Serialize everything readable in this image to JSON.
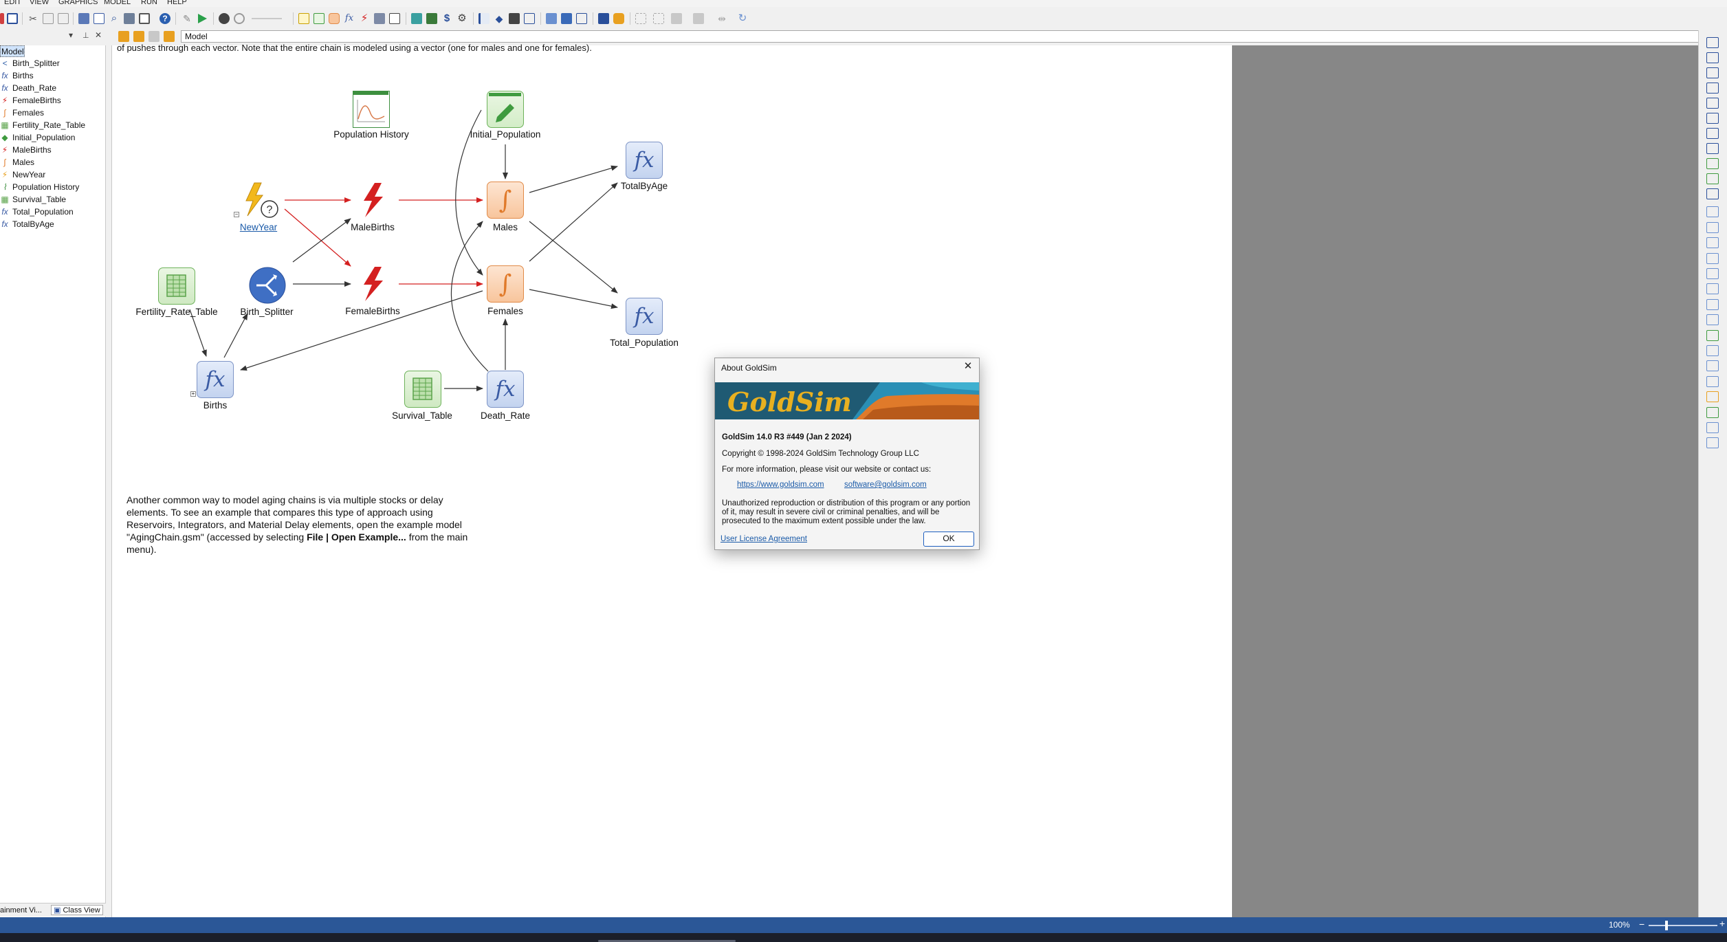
{
  "menu": [
    "EDIT",
    "VIEW",
    "GRAPHICS",
    "MODEL",
    "RUN",
    "HELP"
  ],
  "path_bar": "Model",
  "tree": {
    "root": "Model",
    "items": [
      {
        "label": "Birth_Splitter",
        "icon": "splitter-icon",
        "glyph": "<",
        "color": "#2f5fa8"
      },
      {
        "label": "Births",
        "icon": "function-icon",
        "glyph": "fx",
        "color": "#3a5ba4"
      },
      {
        "label": "Death_Rate",
        "icon": "function-icon",
        "glyph": "fx",
        "color": "#3a5ba4"
      },
      {
        "label": "FemaleBirths",
        "icon": "event-icon",
        "glyph": "⚡",
        "color": "#d42020"
      },
      {
        "label": "Females",
        "icon": "integrator-icon",
        "glyph": "∫",
        "color": "#e07a2a"
      },
      {
        "label": "Fertility_Rate_Table",
        "icon": "table-icon",
        "glyph": "▦",
        "color": "#5aa34a"
      },
      {
        "label": "Initial_Population",
        "icon": "data-icon",
        "glyph": "◆",
        "color": "#3f9b3f"
      },
      {
        "label": "MaleBirths",
        "icon": "event-icon",
        "glyph": "⚡",
        "color": "#d42020"
      },
      {
        "label": "Males",
        "icon": "integrator-icon",
        "glyph": "∫",
        "color": "#e07a2a"
      },
      {
        "label": "NewYear",
        "icon": "timed-event-icon",
        "glyph": "⚡",
        "color": "#e8a020"
      },
      {
        "label": "Population History",
        "icon": "time-history-icon",
        "glyph": "⌇",
        "color": "#3d8f3f"
      },
      {
        "label": "Survival_Table",
        "icon": "table-icon",
        "glyph": "▦",
        "color": "#5aa34a"
      },
      {
        "label": "Total_Population",
        "icon": "function-icon",
        "glyph": "fx",
        "color": "#3a5ba4"
      },
      {
        "label": "TotalByAge",
        "icon": "function-icon",
        "glyph": "fx",
        "color": "#3a5ba4"
      }
    ]
  },
  "panel_tabs": {
    "containment": "ainment Vi...",
    "class_view": "Class View"
  },
  "top_note": "of pushes through each vector. Note that the entire chain is modeled using a vector (one for males and one for females).",
  "nodes": {
    "population_history": "Population History",
    "initial_population": "Initial_Population",
    "totalbyage": "TotalByAge",
    "newyear": "NewYear",
    "malebirths": "MaleBirths",
    "males": "Males",
    "fertility_rate_table": "Fertility_Rate_Table",
    "birth_splitter": "Birth_Splitter",
    "femalebirths": "FemaleBirths",
    "females": "Females",
    "total_population": "Total_Population",
    "births": "Births",
    "survival_table": "Survival_Table",
    "death_rate": "Death_Rate"
  },
  "body_text": {
    "p1": "Another common way to model aging chains is via multiple stocks or delay elements. To see an example that compares this type of approach using Reservoirs, Integrators, and Material Delay elements, open the example model \"AgingChain.gsm\" (accessed by selecting ",
    "bold1": "File | Open Example...",
    "p2": " from the main menu)."
  },
  "dialog": {
    "title": "About GoldSim",
    "logo_text": "GoldSim",
    "version": "GoldSim 14.0 R3 #449 (Jan 2 2024)",
    "copyright": "Copyright © 1998-2024 GoldSim Technology Group LLC",
    "info": "For more information, please visit our website or contact us:",
    "website": "https://www.goldsim.com",
    "email": "software@goldsim.com",
    "legal": "Unauthorized reproduction or distribution of this program or any portion of it, may result in severe civil or criminal penalties, and will be prosecuted to the maximum extent possible under the law.",
    "license_link": "User License Agreement",
    "ok": "OK"
  },
  "status": {
    "zoom": "100%"
  },
  "colors": {
    "arrow_red": "#d42020",
    "arrow_dark": "#333333",
    "status_bar": "#2b5797",
    "gray_area": "#878787"
  }
}
